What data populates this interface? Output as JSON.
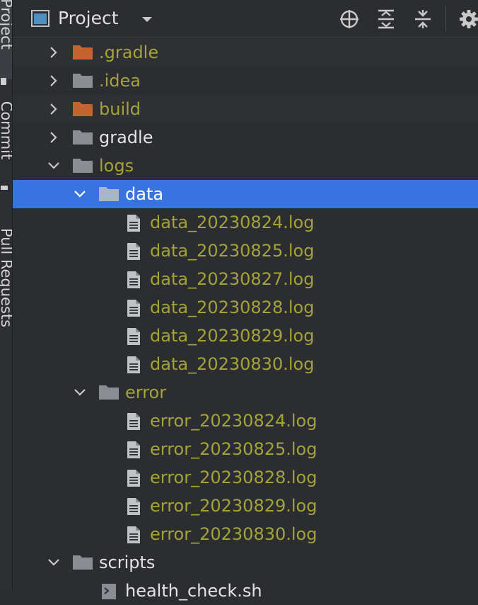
{
  "side_strip": {
    "tabs": [
      "Project",
      "Commit",
      "Pull Requests"
    ]
  },
  "header": {
    "title": "Project"
  },
  "tree": [
    {
      "label": ".gradle",
      "kind": "folder",
      "depth": 0,
      "expanded": false,
      "folder_color": "#c4632f",
      "text_color": "olive",
      "dim": true
    },
    {
      "label": ".idea",
      "kind": "folder",
      "depth": 0,
      "expanded": false,
      "folder_color": "#8a8d92",
      "text_color": "olive",
      "dim": false
    },
    {
      "label": "build",
      "kind": "folder",
      "depth": 0,
      "expanded": false,
      "folder_color": "#c4632f",
      "text_color": "olive",
      "dim": true
    },
    {
      "label": "gradle",
      "kind": "folder",
      "depth": 0,
      "expanded": false,
      "folder_color": "#8a8d92",
      "text_color": "white",
      "dim": false
    },
    {
      "label": "logs",
      "kind": "folder",
      "depth": 0,
      "expanded": true,
      "folder_color": "#8a8d92",
      "text_color": "olive",
      "dim": false
    },
    {
      "label": "data",
      "kind": "folder",
      "depth": 1,
      "expanded": true,
      "folder_color": "#a9b6c9",
      "text_color": "white",
      "selected": true
    },
    {
      "label": "data_20230824.log",
      "kind": "file",
      "depth": 2,
      "text_color": "olive"
    },
    {
      "label": "data_20230825.log",
      "kind": "file",
      "depth": 2,
      "text_color": "olive"
    },
    {
      "label": "data_20230827.log",
      "kind": "file",
      "depth": 2,
      "text_color": "olive"
    },
    {
      "label": "data_20230828.log",
      "kind": "file",
      "depth": 2,
      "text_color": "olive"
    },
    {
      "label": "data_20230829.log",
      "kind": "file",
      "depth": 2,
      "text_color": "olive"
    },
    {
      "label": "data_20230830.log",
      "kind": "file",
      "depth": 2,
      "text_color": "olive"
    },
    {
      "label": "error",
      "kind": "folder",
      "depth": 1,
      "expanded": true,
      "folder_color": "#8a8d92",
      "text_color": "olive"
    },
    {
      "label": "error_20230824.log",
      "kind": "file",
      "depth": 2,
      "text_color": "olive"
    },
    {
      "label": "error_20230825.log",
      "kind": "file",
      "depth": 2,
      "text_color": "olive"
    },
    {
      "label": "error_20230828.log",
      "kind": "file",
      "depth": 2,
      "text_color": "olive"
    },
    {
      "label": "error_20230829.log",
      "kind": "file",
      "depth": 2,
      "text_color": "olive"
    },
    {
      "label": "error_20230830.log",
      "kind": "file",
      "depth": 2,
      "text_color": "olive"
    },
    {
      "label": "scripts",
      "kind": "folder",
      "depth": 0,
      "expanded": true,
      "folder_color": "#8a8d92",
      "text_color": "white"
    },
    {
      "label": "health_check.sh",
      "kind": "script",
      "depth": 1,
      "text_color": "white"
    }
  ],
  "colors": {
    "background": "#2b2d30",
    "selection": "#3874df",
    "olive_text": "#a3a33a",
    "white_text": "#e3e3e3",
    "excluded_folder": "#c4632f",
    "folder": "#8a8d92"
  }
}
